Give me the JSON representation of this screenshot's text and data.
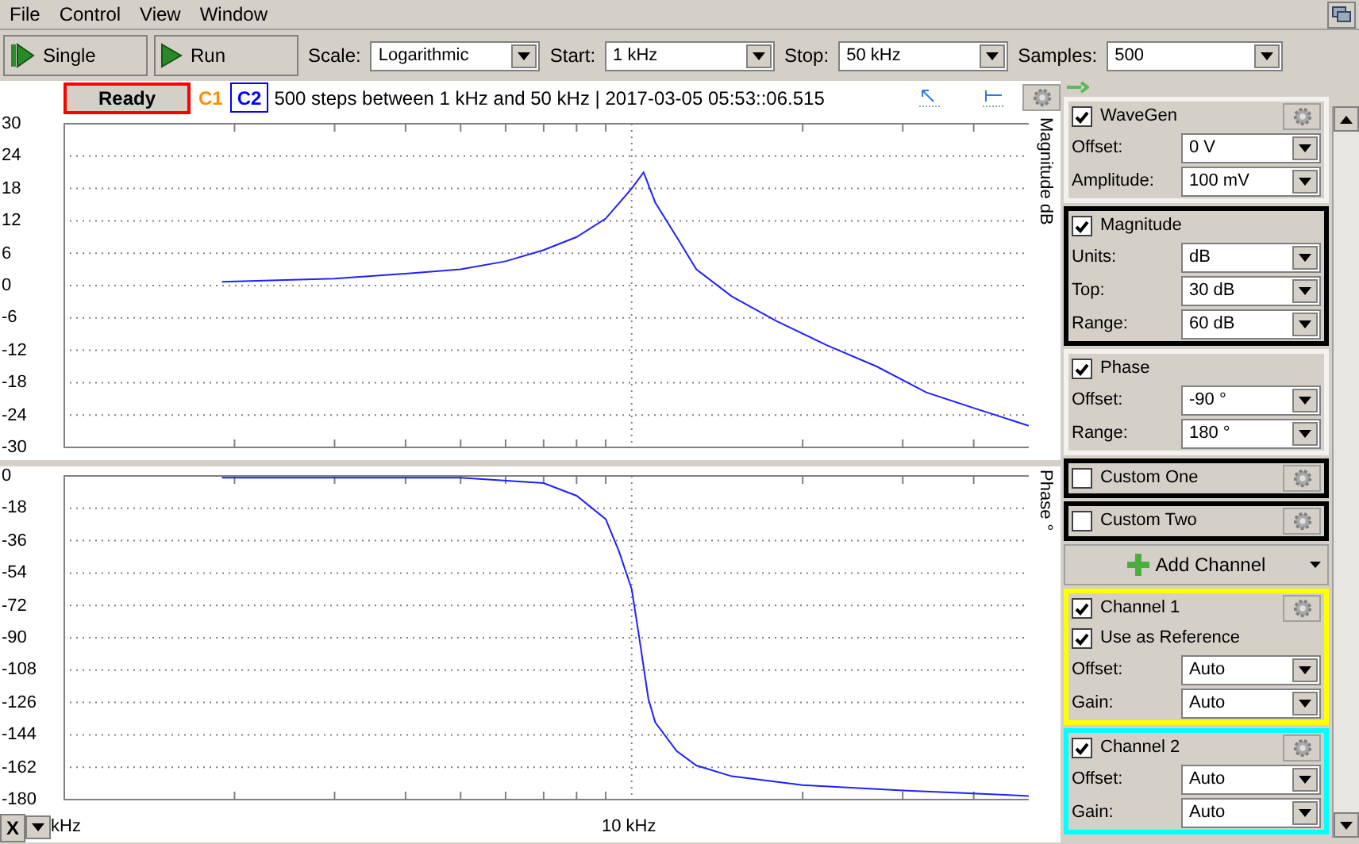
{
  "menu": [
    "File",
    "Control",
    "View",
    "Window"
  ],
  "toolbar": {
    "buttons": [
      {
        "label": "Single",
        "kind": "single"
      },
      {
        "label": "Run",
        "kind": "run"
      }
    ],
    "fields": [
      {
        "label": "Scale:",
        "value": "Logarithmic"
      },
      {
        "label": "Start:",
        "value": "1 kHz"
      },
      {
        "label": "Stop:",
        "value": "50 kHz"
      },
      {
        "label": "Samples:",
        "value": "500"
      }
    ]
  },
  "status": {
    "state": "Ready",
    "c1": "C1",
    "c2": "C2",
    "info": "500 steps  between 1 kHz and 50 kHz | 2017-03-05 05:53::06.515"
  },
  "plots": [
    {
      "kind": "magnitude",
      "axis_label": "Magnitude dB",
      "y_ticks": [
        "30",
        "24",
        "18",
        "12",
        "6",
        "0",
        "-6",
        "-12",
        "-18",
        "-24",
        "-30"
      ]
    },
    {
      "kind": "phase",
      "axis_label": "Phase °",
      "y_ticks": [
        "0",
        "-18",
        "-36",
        "-54",
        "-72",
        "-90",
        "-108",
        "-126",
        "-144",
        "-162",
        "-180"
      ]
    }
  ],
  "x_axis": {
    "button": "X",
    "unit": "kHz",
    "tick_label": "10 kHz"
  },
  "panel": [
    {
      "kind": "group",
      "title": "WaveGen",
      "checked": true,
      "gear": true,
      "fields": [
        {
          "kind": "select",
          "label": "Offset:",
          "value": "0 V"
        },
        {
          "kind": "select",
          "label": "Amplitude:",
          "value": "100 mV"
        }
      ]
    },
    {
      "kind": "group",
      "title": "Magnitude",
      "checked": true,
      "gear": false,
      "color": "#000000",
      "fields": [
        {
          "kind": "select",
          "label": "Units:",
          "value": "dB"
        },
        {
          "kind": "select",
          "label": "Top:",
          "value": "30 dB"
        },
        {
          "kind": "select",
          "label": "Range:",
          "value": "60 dB"
        }
      ]
    },
    {
      "kind": "group",
      "title": "Phase",
      "checked": true,
      "gear": false,
      "fields": [
        {
          "kind": "select",
          "label": "Offset:",
          "value": "-90 °"
        },
        {
          "kind": "select",
          "label": "Range:",
          "value": "180 °"
        }
      ]
    },
    {
      "kind": "group",
      "title": "Custom One",
      "checked": false,
      "gear": true,
      "color": "#000000"
    },
    {
      "kind": "group",
      "title": "Custom Two",
      "checked": false,
      "gear": true,
      "color": "#000000"
    },
    {
      "kind": "button",
      "title": "Add Channel"
    },
    {
      "kind": "group",
      "title": "Channel 1",
      "checked": true,
      "gear": true,
      "color": "#ffff00",
      "fields": [
        {
          "kind": "checkbox",
          "label": "Use as Reference",
          "checked": true
        },
        {
          "kind": "select",
          "label": "Offset:",
          "value": "Auto"
        },
        {
          "kind": "select",
          "label": "Gain:",
          "value": "Auto"
        }
      ]
    },
    {
      "kind": "group",
      "title": "Channel 2",
      "checked": true,
      "gear": true,
      "color": "#00ffff",
      "fields": [
        {
          "kind": "select",
          "label": "Offset:",
          "value": "Auto"
        },
        {
          "kind": "select",
          "label": "Gain:",
          "value": "Auto"
        }
      ]
    }
  ]
}
